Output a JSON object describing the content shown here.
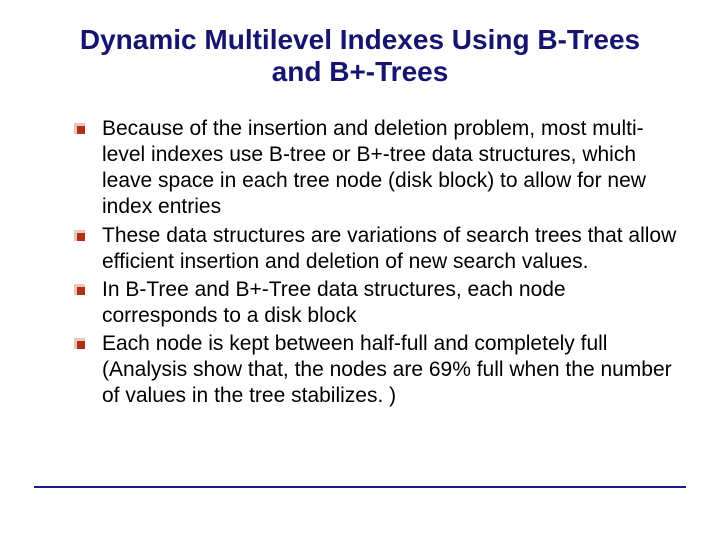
{
  "title_line1": "Dynamic Multilevel Indexes Using B-Trees",
  "title_line2": "and B+-Trees",
  "bullets": [
    "Because of the insertion and deletion problem, most multi-level indexes use B-tree or B+-tree data structures, which leave space in each tree node (disk block) to allow for new index entries",
    "These data structures are variations of search trees that allow efficient insertion and deletion of new search values.",
    "In B-Tree and B+-Tree data structures, each node corresponds to a disk block",
    "Each node is kept between half-full and completely full (Analysis show that, the nodes are 69% full when the number of values in the tree stabilizes. )"
  ]
}
